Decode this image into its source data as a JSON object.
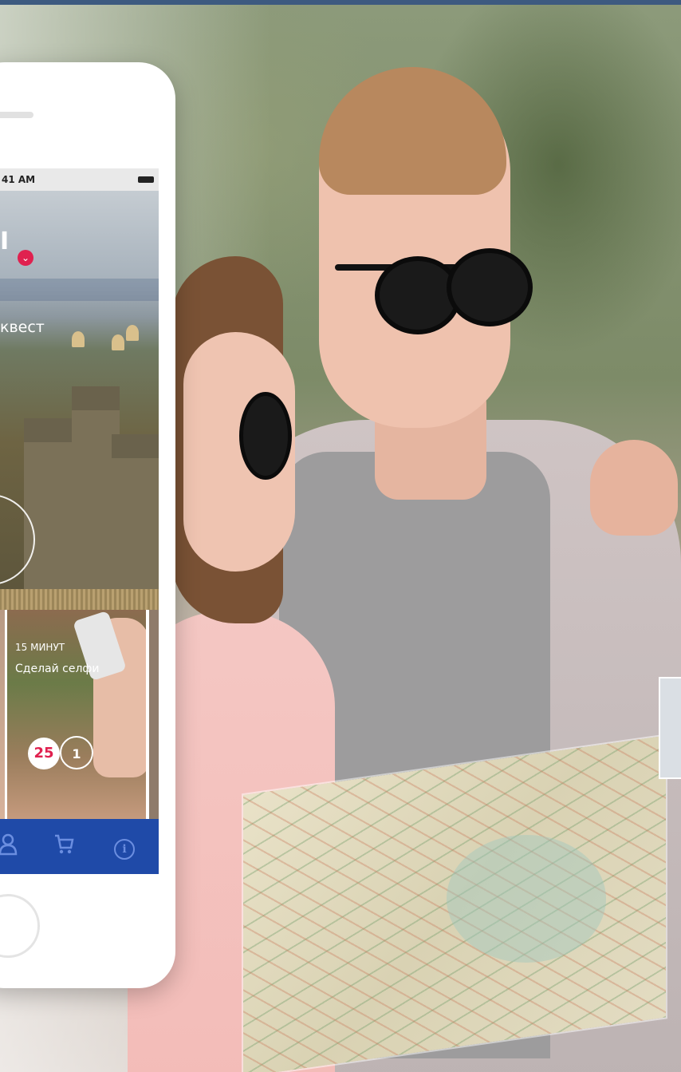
{
  "phone": {
    "status_time": "41 AM",
    "hero_title": "I",
    "hero_subtitle": "квест",
    "card": {
      "time": "15 МИНУТ",
      "title": "Сделай селфи",
      "count_primary": "25",
      "count_secondary": "1"
    },
    "tabs": [
      {
        "name": "profile",
        "icon": "person-icon",
        "glyph": "♙"
      },
      {
        "name": "cart",
        "icon": "cart-icon",
        "glyph": "🛒"
      },
      {
        "name": "info",
        "icon": "info-icon",
        "glyph": "i"
      }
    ]
  },
  "colors": {
    "accent": "#e0214f",
    "tabbar": "#1f4aa8",
    "tab_icon": "#6b8ee0",
    "top_border": "#3d5a80"
  }
}
